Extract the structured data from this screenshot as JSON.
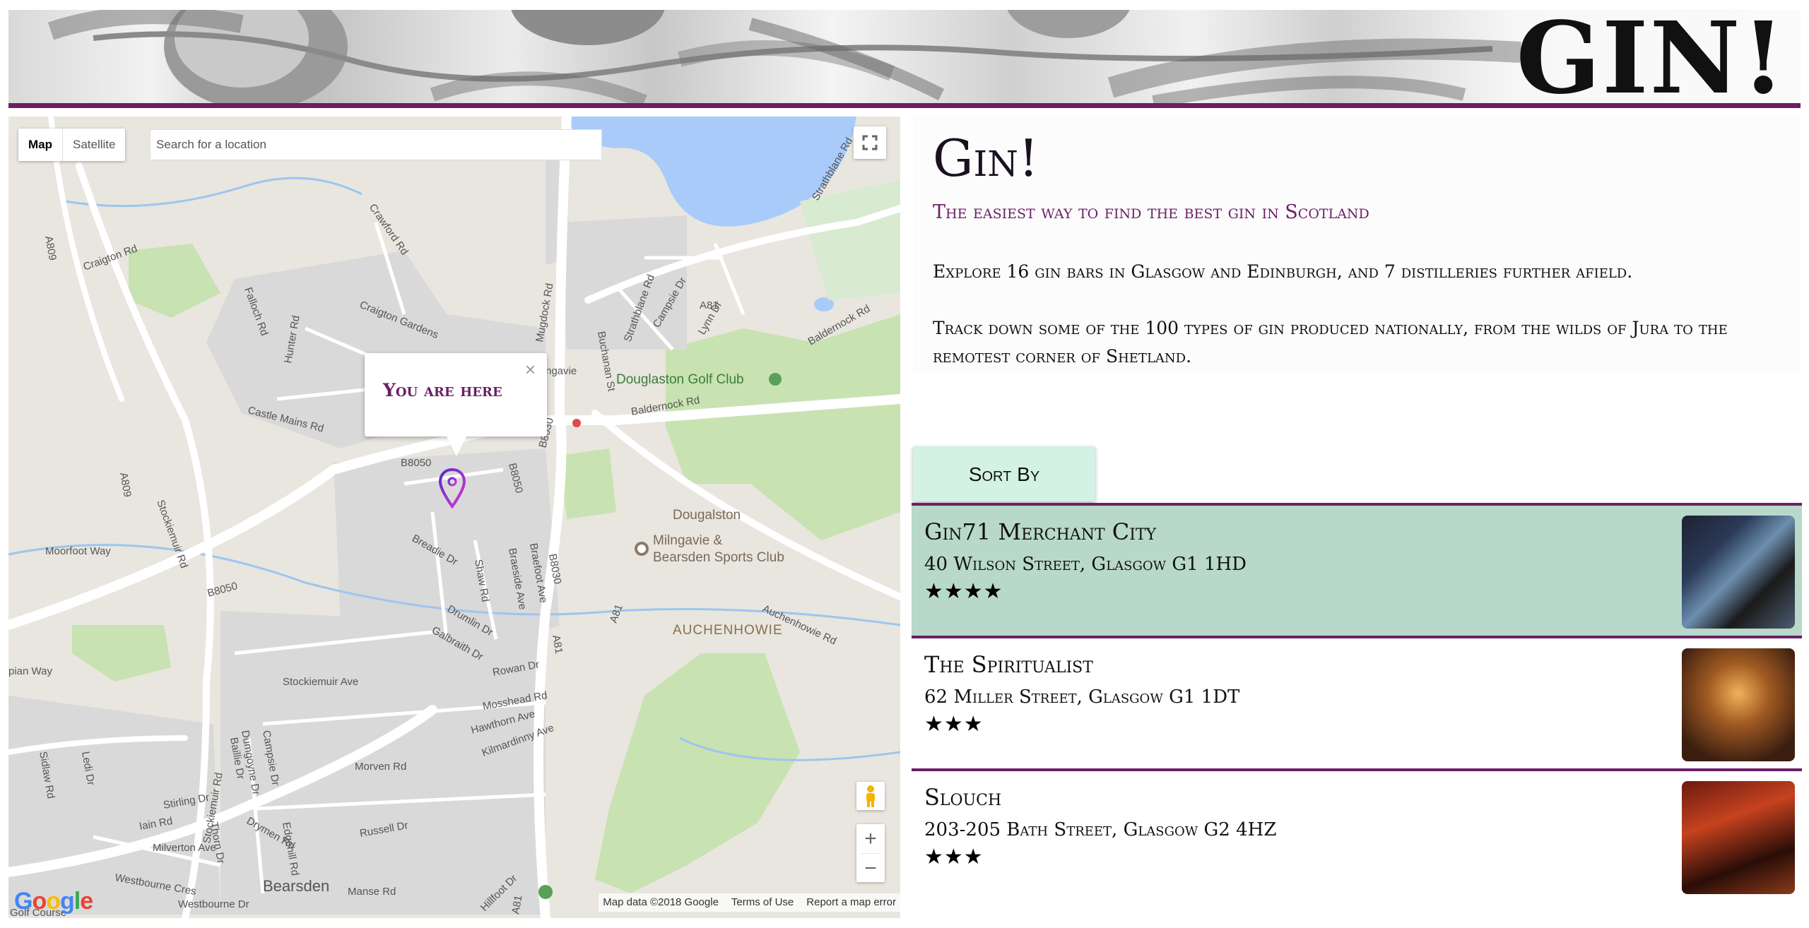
{
  "header": {
    "banner_title": "GIN!"
  },
  "map": {
    "type_map": "Map",
    "type_satellite": "Satellite",
    "search_placeholder": "Search for a location",
    "popup_text": "You are here",
    "popup_close": "×",
    "zoom_in": "+",
    "zoom_out": "−",
    "google_logo": "Google",
    "attribution": {
      "data": "Map data ©2018 Google",
      "terms": "Terms of Use",
      "report": "Report a map error"
    },
    "labels": [
      "Craigton Rd",
      "A809",
      "Crawford Rd",
      "Fallloch Rd",
      "Craigton Gardens",
      "A809",
      "Hunter Rd",
      "Castle Mains Rd",
      "Stockiemuir Rd",
      "Moorfoot Way",
      "B8050",
      "B8050",
      "B8050",
      "Breadie Dr",
      "Shaw Rd",
      "Braeside Ave",
      "Braefoot Ave",
      "B8030",
      "B8030",
      "A81",
      "Drumlin Dr",
      "Galbraith Dr",
      "Mugdock Rd",
      "Strathblane Rd",
      "Buchanan St",
      "Campsie Dr",
      "Lynn Dr",
      "A81",
      "Strathblane Rd",
      "Baldernock Rd",
      "Baldernock Rd",
      "Douglaston Golf Club",
      "Dougalston",
      "Milngavie & Bearsden Sports Club",
      "AUCHENHOWIE",
      "Auchenhowie Rd",
      "Rowan Dr",
      "Mosshead Rd",
      "Hawthorn Ave",
      "Kilmardinny Ave",
      "Stockiemuir Ave",
      "Dumgoyne Dr",
      "Campsie Dr",
      "Baillie Dr",
      "Edgehill Rd",
      "Morven Rd",
      "Drymen Rd",
      "Stirling Dr",
      "Iain Rd",
      "Milverton Ave",
      "Thorn Dr",
      "Russell Dr",
      "Westbourne Cres",
      "Westbourne Dr",
      "Bearsden",
      "Manse Rd",
      "Hillfoot Dr",
      "A81",
      "Sidlaw Rd",
      "Ledi Dr",
      "ngavie",
      "pian Way",
      "Golf Course"
    ]
  },
  "info": {
    "title": "Gin!",
    "subtitle": "The easiest way to find the best gin in Scotland",
    "para1": "Explore 16 gin bars in Glasgow and Edinburgh, and 7 distilleries further afield.",
    "para2": "Track down some of the 100 types of gin produced nationally, from the wilds of Jura to the remotest corner of Shetland."
  },
  "sort_button": "Sort By",
  "bars": [
    {
      "name": "Gin71 Merchant City",
      "address": "40 Wilson Street, Glasgow G1 1HD",
      "stars": "★★★★",
      "rating": 4
    },
    {
      "name": "The Spiritualist",
      "address": "62 Miller Street, Glasgow G1 1DT",
      "stars": "★★★",
      "rating": 3
    },
    {
      "name": "Slouch",
      "address": "203-205 Bath Street, Glasgow G2 4HZ",
      "stars": "★★★",
      "rating": 3
    }
  ],
  "colors": {
    "accent": "#6b1f66",
    "selected_row": "#b8d8ca",
    "sort_button": "#d3f1e4"
  }
}
